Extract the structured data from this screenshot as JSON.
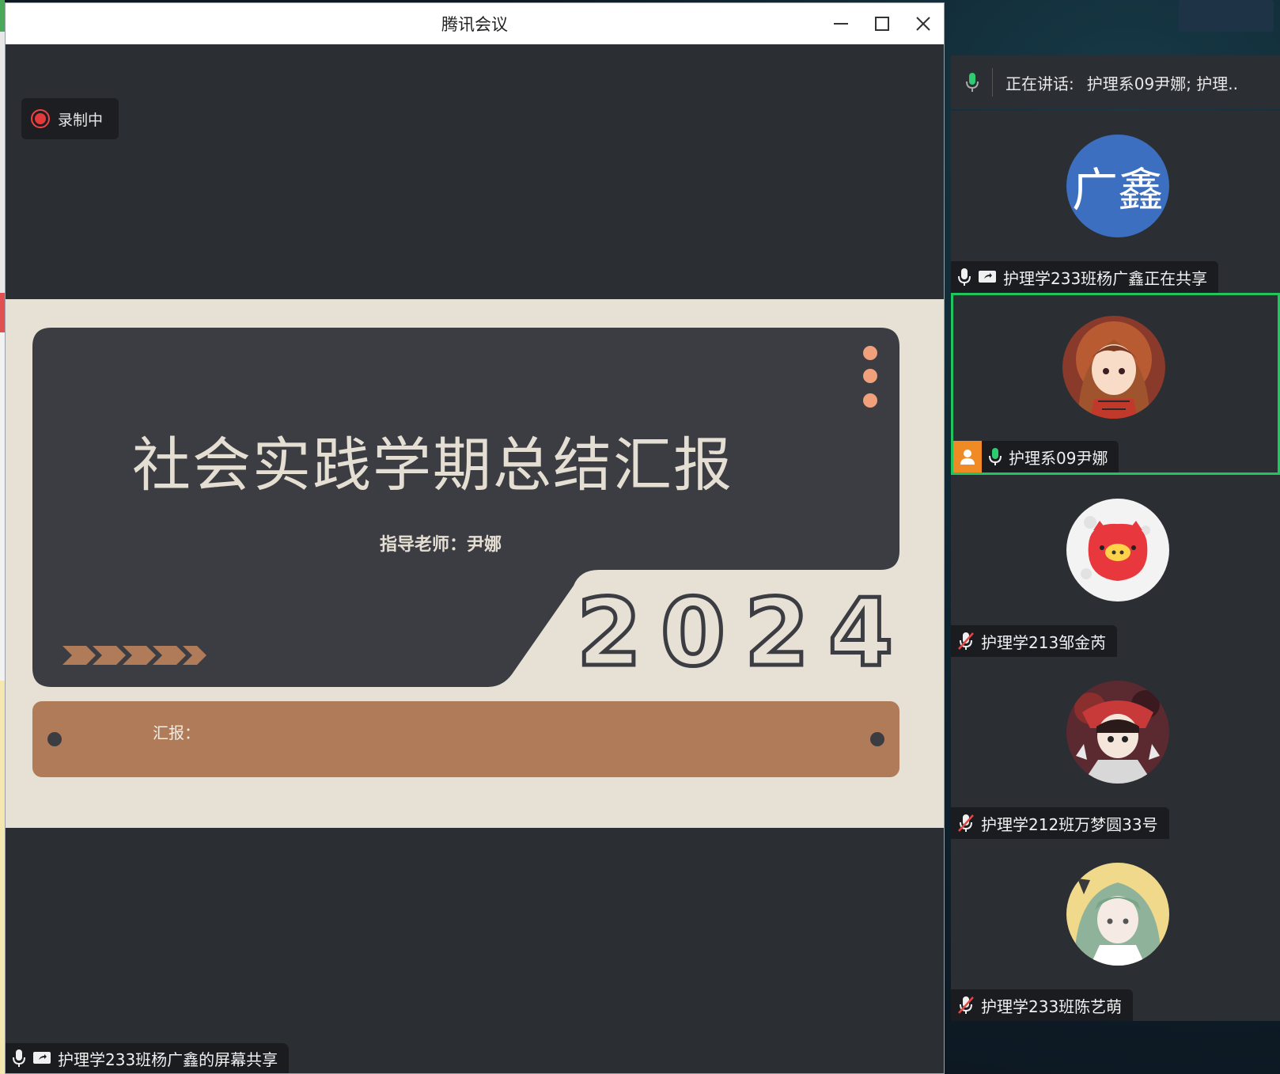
{
  "window": {
    "title": "腾讯会议"
  },
  "recording": {
    "label": "录制中"
  },
  "slide": {
    "title": "社会实践学期总结汇报",
    "subtitle": "指导老师：尹娜",
    "year_digits": [
      "2",
      "0",
      "2",
      "4"
    ],
    "footer_label": "汇报："
  },
  "screen_share": {
    "label": "护理学233班杨广鑫的屏幕共享"
  },
  "side_panel": {
    "speaking_prefix": "正在讲话:",
    "speaking_names": "护理系09尹娜; 护理..",
    "participants": [
      {
        "name": "护理学233班杨广鑫正在共享",
        "avatar_text": "广鑫",
        "mic": "on",
        "sharing": true
      },
      {
        "name": "护理系09尹娜",
        "mic": "active",
        "host": true,
        "speaking": true
      },
      {
        "name": "护理学213邹金芮",
        "mic": "muted"
      },
      {
        "name": "护理学212班万梦圆33号",
        "mic": "muted"
      },
      {
        "name": "护理学233班陈艺萌",
        "mic": "muted"
      }
    ]
  },
  "colors": {
    "slide_bg": "#e7e0d4",
    "slide_panel": "#3c3d43",
    "slide_accent": "#b07b58",
    "dot_accent": "#f0a07a",
    "active_border": "#21c55e",
    "mute_red": "#e84545",
    "mic_green": "#2ecc71",
    "host_orange": "#f08a24"
  }
}
